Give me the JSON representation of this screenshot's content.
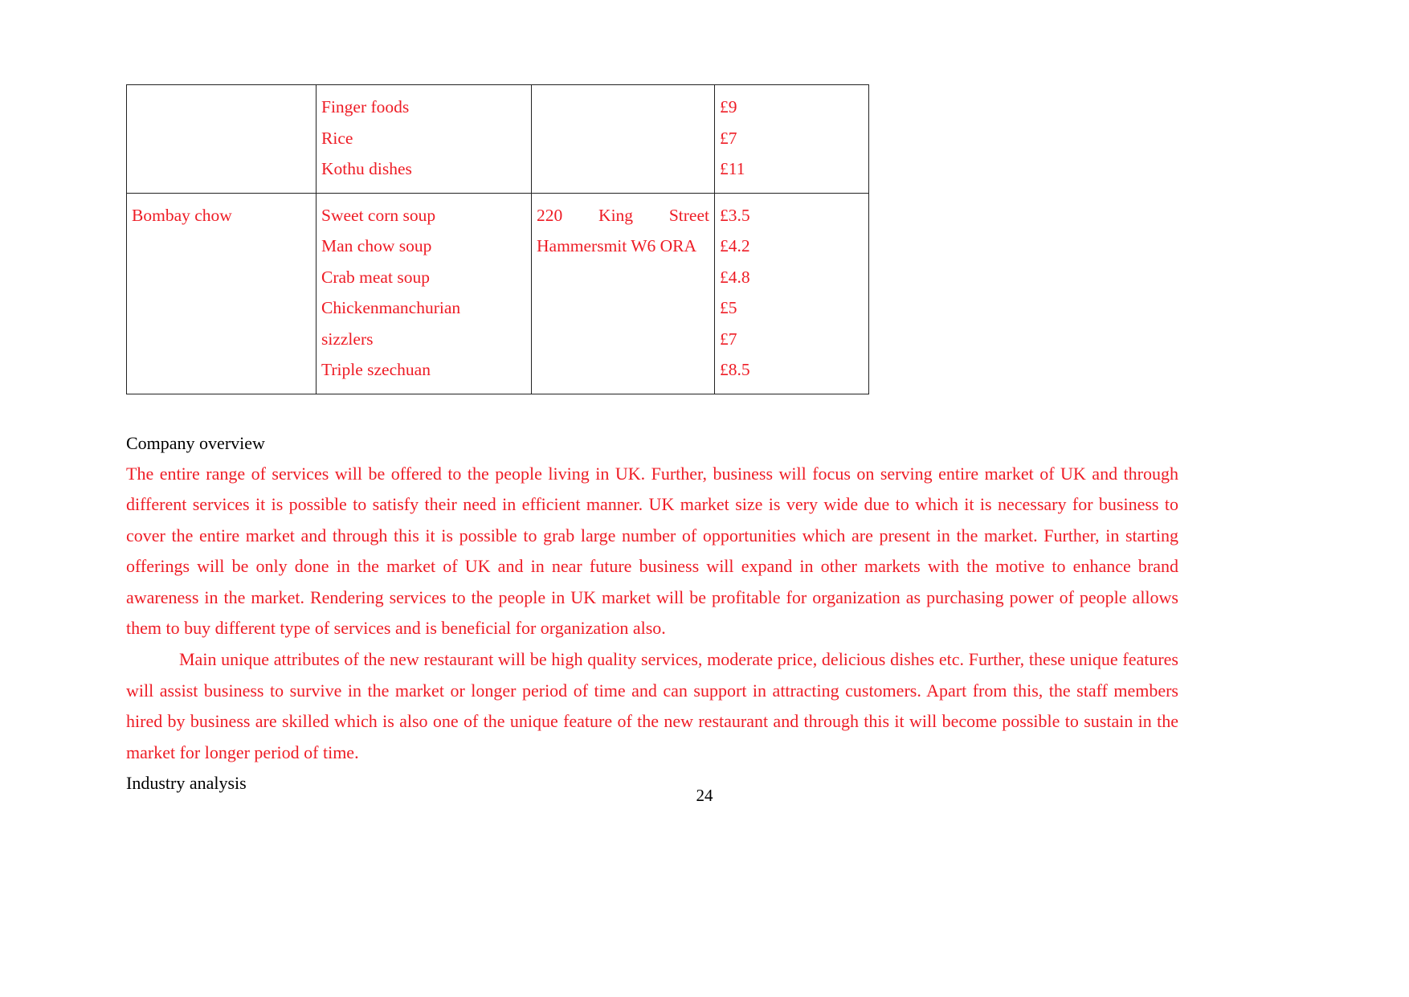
{
  "document": {
    "page_number": "24",
    "text_color_body": "#ee1c25",
    "text_color_heading": "#000000",
    "border_color": "#222222"
  },
  "menu_table": {
    "rows": [
      {
        "restaurant": "",
        "dishes": [
          "Finger foods",
          "Rice",
          "Kothu dishes"
        ],
        "address": [],
        "prices": [
          "£9",
          "£7",
          "£11"
        ]
      },
      {
        "restaurant": "Bombay chow",
        "dishes": [
          "Sweet corn soup",
          "Man chow soup",
          "Crab meat soup",
          "Chicken manchurian",
          "sizzlers",
          "Triple szechuan"
        ],
        "address": [
          "220 King Street",
          "Hammersmit W6 ORA"
        ],
        "prices": [
          "£3.5",
          "£4.2",
          "£4.8",
          "£5",
          "£7",
          "£8.5"
        ]
      }
    ],
    "row2_dish_wrapped": {
      "part_a": "Chicken",
      "part_b": "manchurian"
    }
  },
  "sections": {
    "company_overview": {
      "heading": "Company overview",
      "paragraph_1": "The entire range of services will be offered to the people living in UK. Further, business will focus on serving entire market of UK and through different services it is possible to satisfy their need in efficient manner. UK market size is very wide due to which it is necessary for business to cover the entire market and through this it is possible to grab large number of opportunities which are present in the market. Further, in starting offerings will be only done in the market of UK and in near future business will expand in other markets with the motive to enhance brand awareness in the market. Rendering services to the people in UK market will be profitable for organization as purchasing power of people allows them to buy different type of services and is beneficial for organization also.",
      "paragraph_2": "Main unique attributes of the new restaurant will be high quality services, moderate price, delicious dishes etc. Further, these unique features will assist business to survive in the market or longer period of time and can support in attracting customers. Apart from this, the staff members hired by business are skilled which is also one of the unique feature of the new restaurant and through this it will become possible to sustain in the market for longer period of time."
    },
    "industry_analysis": {
      "heading": "Industry analysis"
    }
  }
}
